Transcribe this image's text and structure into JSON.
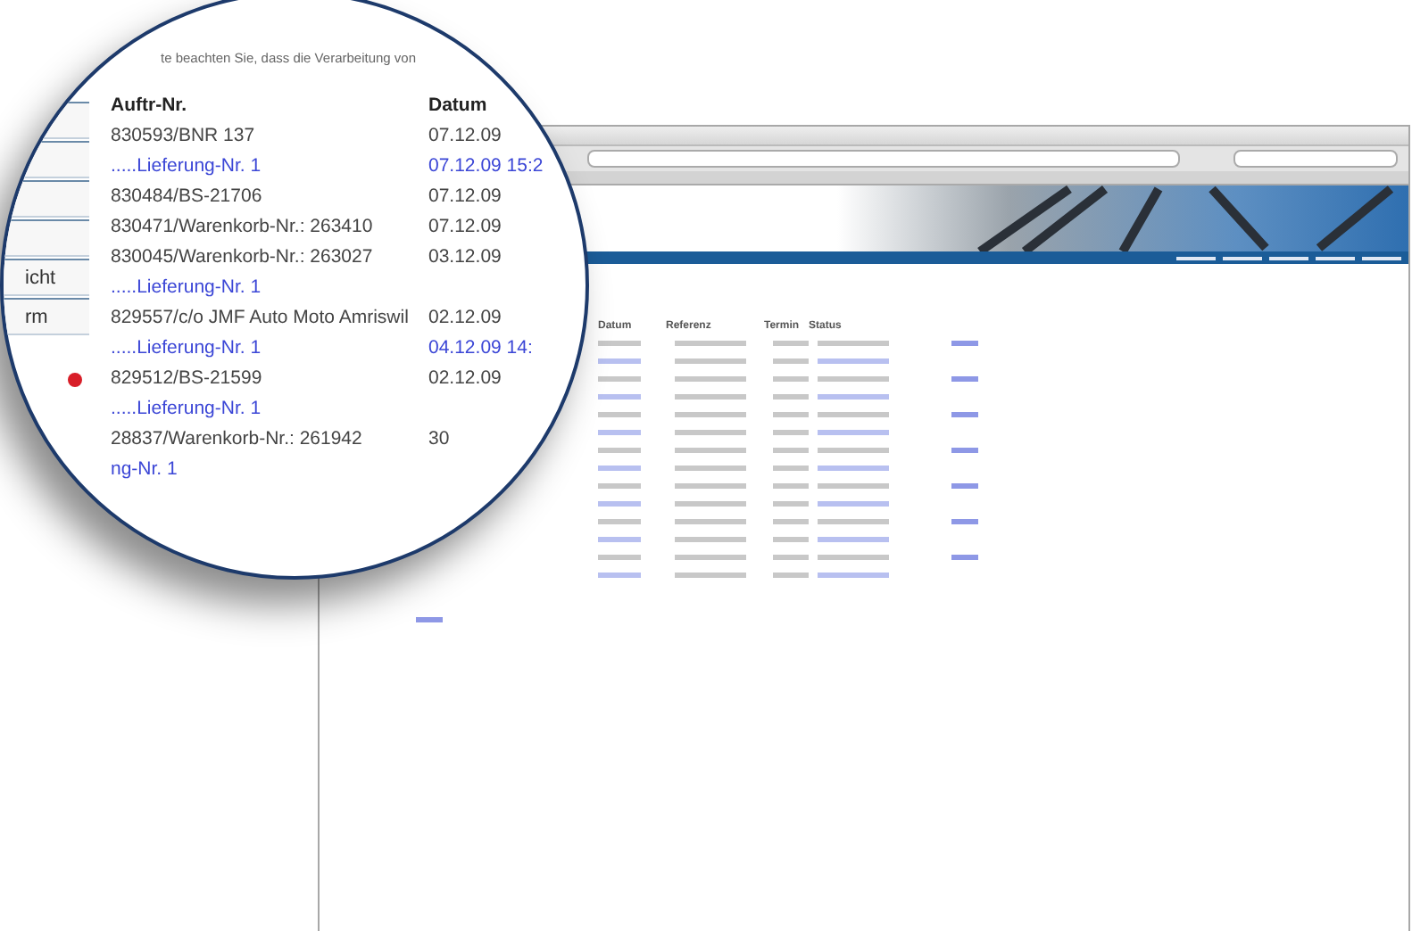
{
  "background_page": {
    "columns": [
      "Datum",
      "Referenz",
      "Termin",
      "Status"
    ]
  },
  "magnifier": {
    "note": "te beachten Sie, dass die Verarbeitung von",
    "sidebar_items": [
      {
        "label": "icht"
      },
      {
        "label": "rm"
      }
    ],
    "columns": [
      "Auftr-Nr.",
      "Datum"
    ],
    "rows": [
      {
        "kind": "order",
        "number": "830593/BNR 137",
        "date": "07.12.09"
      },
      {
        "kind": "delivery",
        "number": ".....Lieferung-Nr. 1",
        "date": "07.12.09 15:2"
      },
      {
        "kind": "order",
        "number": "830484/BS-21706",
        "date": "07.12.09"
      },
      {
        "kind": "order",
        "number": "830471/Warenkorb-Nr.: 263410",
        "date": "07.12.09"
      },
      {
        "kind": "order",
        "number": "830045/Warenkorb-Nr.: 263027",
        "date": "03.12.09"
      },
      {
        "kind": "delivery",
        "number": ".....Lieferung-Nr. 1"
      },
      {
        "kind": "order",
        "number": "829557/c/o JMF Auto Moto Amriswil",
        "date": "02.12.09"
      },
      {
        "kind": "delivery",
        "number": ".....Lieferung-Nr. 1",
        "date": "04.12.09 14:"
      },
      {
        "kind": "order",
        "number": "829512/BS-21599",
        "date": "02.12.09"
      },
      {
        "kind": "delivery",
        "number": ".....Lieferung-Nr. 1"
      },
      {
        "kind": "order",
        "number": "28837/Warenkorb-Nr.: 261942",
        "date": "30"
      },
      {
        "kind": "delivery",
        "number": "ng-Nr. 1"
      }
    ]
  }
}
